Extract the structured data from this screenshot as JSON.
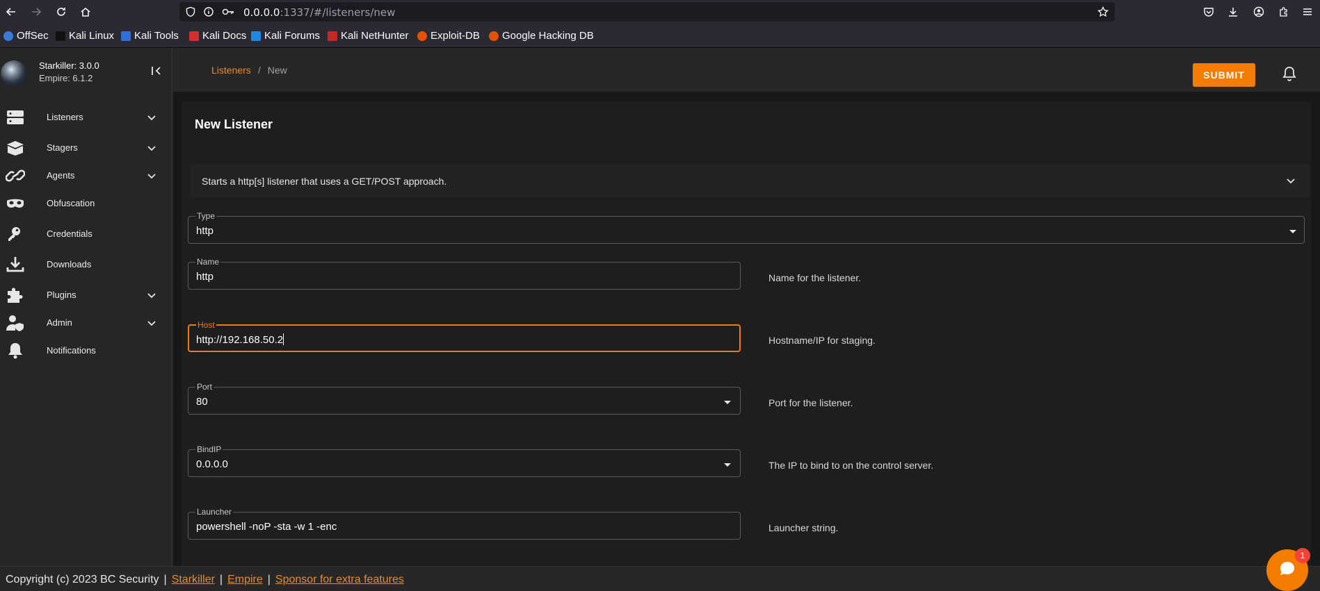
{
  "browser": {
    "url_host": "0.0.0.0",
    "url_rest": ":1337/#/listeners/new",
    "bookmarks": [
      {
        "label": "OffSec",
        "color": "#3a7bd5"
      },
      {
        "label": "Kali Linux",
        "color": "#222222"
      },
      {
        "label": "Kali Tools",
        "color": "#2f6fd8"
      },
      {
        "label": "Kali Docs",
        "color": "#d32f2f"
      },
      {
        "label": "Kali Forums",
        "color": "#1e88e5"
      },
      {
        "label": "Kali NetHunter",
        "color": "#c62828"
      },
      {
        "label": "Exploit-DB",
        "color": "#e65100"
      },
      {
        "label": "Google Hacking DB",
        "color": "#e65100"
      }
    ]
  },
  "brand": {
    "title": "Starkiller: 3.0.0",
    "subtitle": "Empire: 6.1.2"
  },
  "sidebar": {
    "items": [
      {
        "label": "Listeners",
        "icon": "server-stack-icon",
        "expandable": true
      },
      {
        "label": "Stagers",
        "icon": "package-open-icon",
        "expandable": true
      },
      {
        "label": "Agents",
        "icon": "link-chain-icon",
        "expandable": true
      },
      {
        "label": "Obfuscation",
        "icon": "mask-icon",
        "expandable": false
      },
      {
        "label": "Credentials",
        "icon": "key-icon",
        "expandable": false
      },
      {
        "label": "Downloads",
        "icon": "download-icon",
        "expandable": false
      },
      {
        "label": "Plugins",
        "icon": "puzzle-icon",
        "expandable": true
      },
      {
        "label": "Admin",
        "icon": "user-shield-icon",
        "expandable": true
      },
      {
        "label": "Notifications",
        "icon": "bell-icon",
        "expandable": false
      }
    ]
  },
  "breadcrumb": {
    "parent": "Listeners",
    "separator": "/",
    "current": "New"
  },
  "actions": {
    "submit_label": "SUBMIT"
  },
  "form": {
    "title": "New Listener",
    "description": "Starts a http[s] listener that uses a GET/POST approach.",
    "type": {
      "label": "Type",
      "value": "http"
    },
    "name": {
      "label": "Name",
      "value": "http",
      "hint": "Name for the listener."
    },
    "host": {
      "label": "Host",
      "value": "http://192.168.50.2",
      "hint": "Hostname/IP for staging."
    },
    "port": {
      "label": "Port",
      "value": "80",
      "hint": "Port for the listener."
    },
    "bindip": {
      "label": "BindIP",
      "value": "0.0.0.0",
      "hint": "The IP to bind to on the control server."
    },
    "launcher": {
      "label": "Launcher",
      "value": "powershell -noP -sta -w 1 -enc",
      "hint": "Launcher string."
    }
  },
  "footer": {
    "copyright": "Copyright (c) 2023 BC Security",
    "sep": "|",
    "links": [
      "Starkiller",
      "Empire",
      "Sponsor for extra features"
    ]
  },
  "chat": {
    "badge_count": "1"
  },
  "colors": {
    "accent": "#f57c00",
    "background": "#1e1e1e",
    "sidebar": "#262626"
  }
}
